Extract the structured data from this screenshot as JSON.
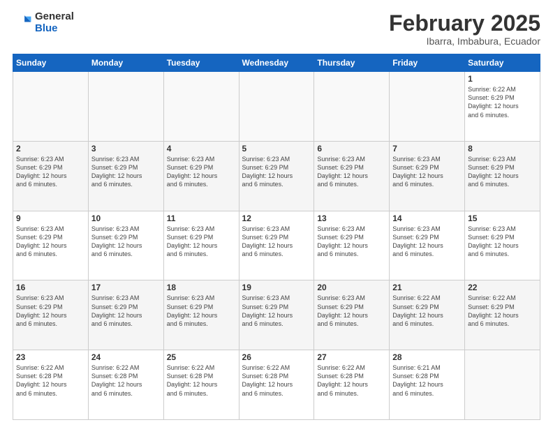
{
  "logo": {
    "line1": "General",
    "line2": "Blue"
  },
  "title": {
    "month_year": "February 2025",
    "location": "Ibarra, Imbabura, Ecuador"
  },
  "days_of_week": [
    "Sunday",
    "Monday",
    "Tuesday",
    "Wednesday",
    "Thursday",
    "Friday",
    "Saturday"
  ],
  "weeks": [
    [
      {
        "day": "",
        "info": ""
      },
      {
        "day": "",
        "info": ""
      },
      {
        "day": "",
        "info": ""
      },
      {
        "day": "",
        "info": ""
      },
      {
        "day": "",
        "info": ""
      },
      {
        "day": "",
        "info": ""
      },
      {
        "day": "1",
        "info": "Sunrise: 6:22 AM\nSunset: 6:29 PM\nDaylight: 12 hours\nand 6 minutes."
      }
    ],
    [
      {
        "day": "2",
        "info": "Sunrise: 6:23 AM\nSunset: 6:29 PM\nDaylight: 12 hours\nand 6 minutes."
      },
      {
        "day": "3",
        "info": "Sunrise: 6:23 AM\nSunset: 6:29 PM\nDaylight: 12 hours\nand 6 minutes."
      },
      {
        "day": "4",
        "info": "Sunrise: 6:23 AM\nSunset: 6:29 PM\nDaylight: 12 hours\nand 6 minutes."
      },
      {
        "day": "5",
        "info": "Sunrise: 6:23 AM\nSunset: 6:29 PM\nDaylight: 12 hours\nand 6 minutes."
      },
      {
        "day": "6",
        "info": "Sunrise: 6:23 AM\nSunset: 6:29 PM\nDaylight: 12 hours\nand 6 minutes."
      },
      {
        "day": "7",
        "info": "Sunrise: 6:23 AM\nSunset: 6:29 PM\nDaylight: 12 hours\nand 6 minutes."
      },
      {
        "day": "8",
        "info": "Sunrise: 6:23 AM\nSunset: 6:29 PM\nDaylight: 12 hours\nand 6 minutes."
      }
    ],
    [
      {
        "day": "9",
        "info": "Sunrise: 6:23 AM\nSunset: 6:29 PM\nDaylight: 12 hours\nand 6 minutes."
      },
      {
        "day": "10",
        "info": "Sunrise: 6:23 AM\nSunset: 6:29 PM\nDaylight: 12 hours\nand 6 minutes."
      },
      {
        "day": "11",
        "info": "Sunrise: 6:23 AM\nSunset: 6:29 PM\nDaylight: 12 hours\nand 6 minutes."
      },
      {
        "day": "12",
        "info": "Sunrise: 6:23 AM\nSunset: 6:29 PM\nDaylight: 12 hours\nand 6 minutes."
      },
      {
        "day": "13",
        "info": "Sunrise: 6:23 AM\nSunset: 6:29 PM\nDaylight: 12 hours\nand 6 minutes."
      },
      {
        "day": "14",
        "info": "Sunrise: 6:23 AM\nSunset: 6:29 PM\nDaylight: 12 hours\nand 6 minutes."
      },
      {
        "day": "15",
        "info": "Sunrise: 6:23 AM\nSunset: 6:29 PM\nDaylight: 12 hours\nand 6 minutes."
      }
    ],
    [
      {
        "day": "16",
        "info": "Sunrise: 6:23 AM\nSunset: 6:29 PM\nDaylight: 12 hours\nand 6 minutes."
      },
      {
        "day": "17",
        "info": "Sunrise: 6:23 AM\nSunset: 6:29 PM\nDaylight: 12 hours\nand 6 minutes."
      },
      {
        "day": "18",
        "info": "Sunrise: 6:23 AM\nSunset: 6:29 PM\nDaylight: 12 hours\nand 6 minutes."
      },
      {
        "day": "19",
        "info": "Sunrise: 6:23 AM\nSunset: 6:29 PM\nDaylight: 12 hours\nand 6 minutes."
      },
      {
        "day": "20",
        "info": "Sunrise: 6:23 AM\nSunset: 6:29 PM\nDaylight: 12 hours\nand 6 minutes."
      },
      {
        "day": "21",
        "info": "Sunrise: 6:22 AM\nSunset: 6:29 PM\nDaylight: 12 hours\nand 6 minutes."
      },
      {
        "day": "22",
        "info": "Sunrise: 6:22 AM\nSunset: 6:29 PM\nDaylight: 12 hours\nand 6 minutes."
      }
    ],
    [
      {
        "day": "23",
        "info": "Sunrise: 6:22 AM\nSunset: 6:28 PM\nDaylight: 12 hours\nand 6 minutes."
      },
      {
        "day": "24",
        "info": "Sunrise: 6:22 AM\nSunset: 6:28 PM\nDaylight: 12 hours\nand 6 minutes."
      },
      {
        "day": "25",
        "info": "Sunrise: 6:22 AM\nSunset: 6:28 PM\nDaylight: 12 hours\nand 6 minutes."
      },
      {
        "day": "26",
        "info": "Sunrise: 6:22 AM\nSunset: 6:28 PM\nDaylight: 12 hours\nand 6 minutes."
      },
      {
        "day": "27",
        "info": "Sunrise: 6:22 AM\nSunset: 6:28 PM\nDaylight: 12 hours\nand 6 minutes."
      },
      {
        "day": "28",
        "info": "Sunrise: 6:21 AM\nSunset: 6:28 PM\nDaylight: 12 hours\nand 6 minutes."
      },
      {
        "day": "",
        "info": ""
      }
    ]
  ]
}
